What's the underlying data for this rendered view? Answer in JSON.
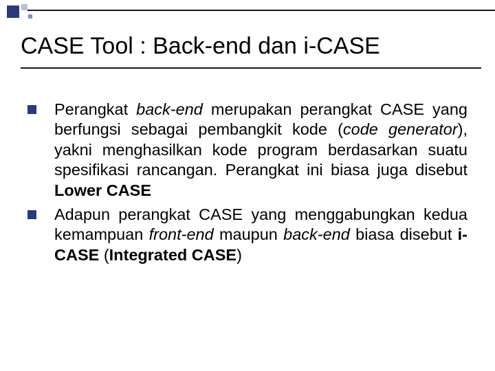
{
  "slide": {
    "title": "CASE Tool : Back-end dan i-CASE",
    "bullets": [
      {
        "html": "Perangkat <i>back-end</i> merupakan perangkat CASE yang berfungsi sebagai pembangkit kode (<i>code generator</i>), yakni menghasilkan kode program berdasarkan suatu spesifikasi rancangan. Perangkat ini biasa juga disebut <b>Lower CASE</b>"
      },
      {
        "html": "Adapun perangkat CASE yang menggabungkan kedua kemampuan <i>front-end</i> maupun <i>back-end</i> biasa disebut <b>i-CASE</b> (<b>Integrated CASE</b>)"
      }
    ]
  }
}
